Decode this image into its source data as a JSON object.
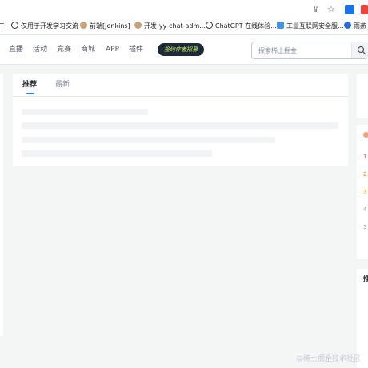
{
  "browser": {
    "bookmarks": [
      {
        "label": "T"
      },
      {
        "label": "仅用于开发学习交流"
      },
      {
        "label": "前端[Jenkins]"
      },
      {
        "label": "开发-yy-chat-adm..."
      },
      {
        "label": "ChatGPT 在线体验..."
      },
      {
        "label": "工业互联网安全服..."
      },
      {
        "label": "雨燕"
      }
    ]
  },
  "nav": {
    "items": [
      "直播",
      "活动",
      "竞赛",
      "商城",
      "APP",
      "插件"
    ],
    "promo_label": "签约作者招募",
    "search_placeholder": "探索稀土掘金"
  },
  "feed": {
    "tabs": [
      {
        "label": "推荐",
        "active": true
      },
      {
        "label": "最新",
        "active": false
      }
    ]
  },
  "right_sidebar": {
    "numbers": [
      "1",
      "2",
      "3",
      "4",
      "5"
    ],
    "section_title": "推"
  },
  "watermark": "@稀土掘金技术社区"
}
